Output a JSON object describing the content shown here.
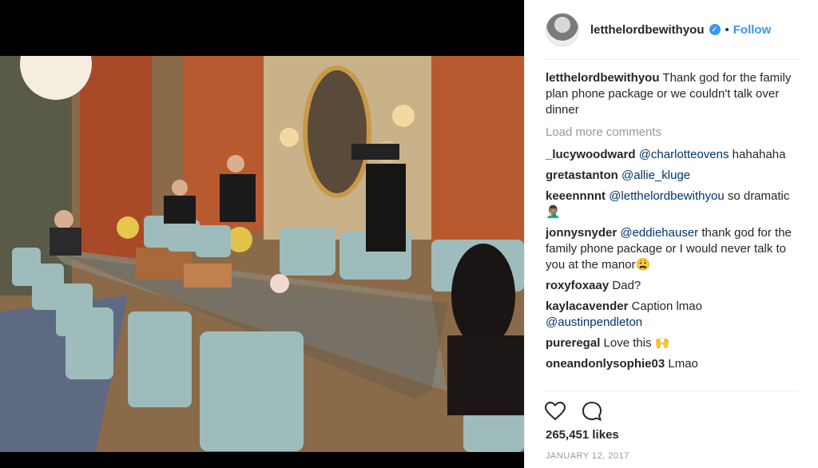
{
  "post": {
    "username": "letthelordbewithyou",
    "verified_icon": "verified-badge-icon",
    "separator": "•",
    "follow_label": "Follow",
    "caption_user": "letthelordbewithyou",
    "caption_text": "Thank god for the family plan phone package or we couldn't talk over dinner",
    "load_more_label": "Load more comments",
    "comments": [
      {
        "user": "_lucywoodward",
        "mention": "@charlotteovens",
        "text": " hahahaha"
      },
      {
        "user": "gretastanton",
        "mention": "@allie_kluge",
        "text": ""
      },
      {
        "user": "keeennnnt",
        "mention": "@letthelordbewithyou",
        "text": " so dramatic 🤦🏽‍♂️"
      },
      {
        "user": "jonnysnyder",
        "mention": "@eddiehauser",
        "text": " thank god for the family phone package or I would never talk to you at the manor😩"
      },
      {
        "user": "roxyfoxaay",
        "mention": "",
        "text": "Dad?"
      },
      {
        "user": "kaylacavender",
        "mention": "",
        "text": "Caption lmao ",
        "mention2": "@austinpendleton"
      },
      {
        "user": "pureregal",
        "mention": "",
        "text": "Love this 🙌"
      },
      {
        "user": "oneandonlysophie03",
        "mention": "",
        "text": "Lmao"
      }
    ],
    "likes_label": "265,451 likes",
    "date_label": "JANUARY 12, 2017",
    "icons": {
      "like": "heart-icon",
      "comment": "comment-bubble-icon"
    },
    "colors": {
      "accent": "#3897f0",
      "mention": "#003569",
      "muted": "#999999"
    }
  }
}
